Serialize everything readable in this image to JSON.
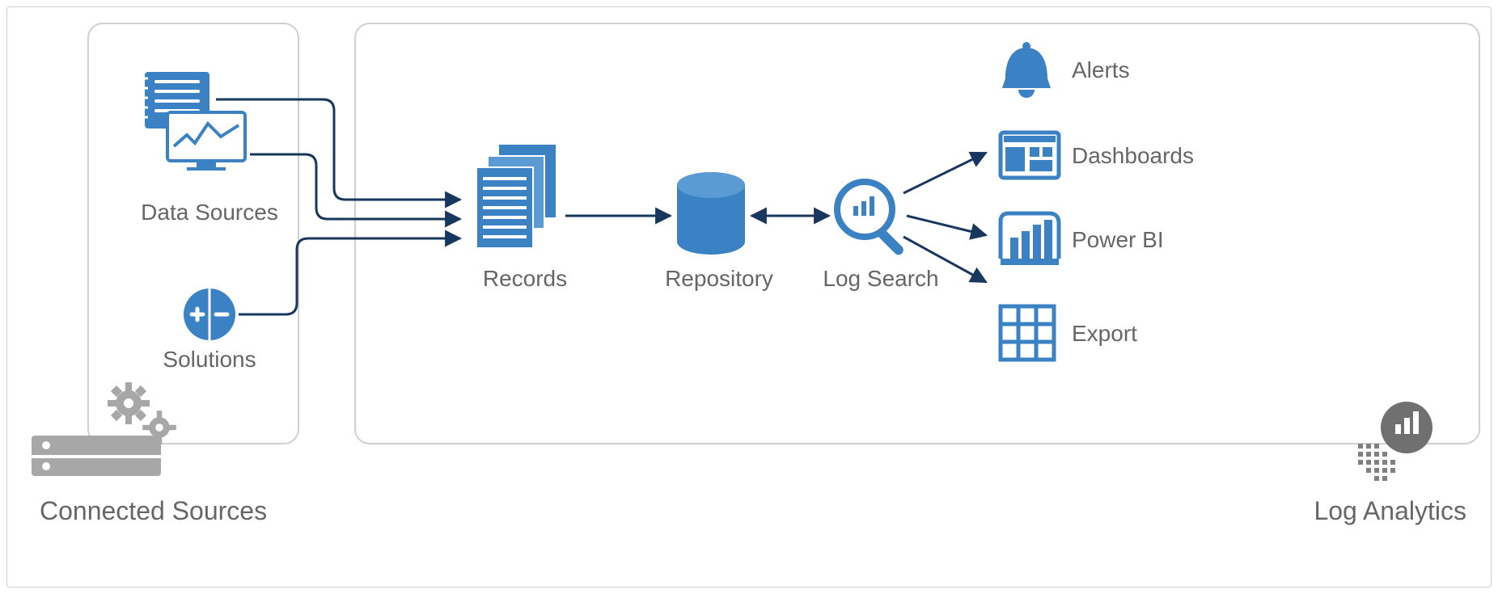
{
  "labels": {
    "data_sources": "Data Sources",
    "solutions": "Solutions",
    "records": "Records",
    "repository": "Repository",
    "log_search": "Log Search",
    "alerts": "Alerts",
    "dashboards": "Dashboards",
    "power_bi": "Power BI",
    "export": "Export",
    "connected_sources": "Connected Sources",
    "log_analytics": "Log Analytics"
  },
  "colors": {
    "primary": "#3a82c4",
    "primary_dark": "#17375e",
    "gray": "#888888",
    "light_gray": "#cccccc",
    "border": "#d0d0d0"
  }
}
